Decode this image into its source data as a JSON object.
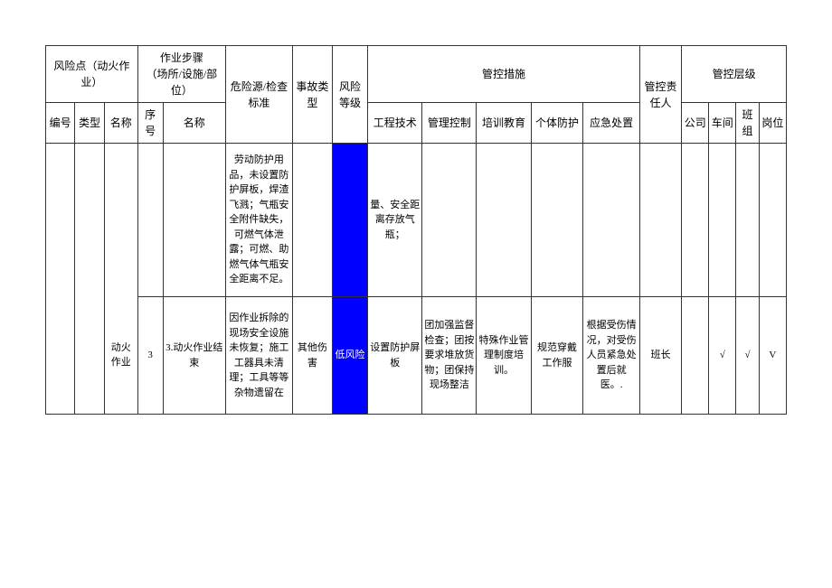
{
  "header": {
    "risk_point": "风险点（动火作业）",
    "work_steps": "作业步骤\n（场所/设施/部位）",
    "hazard_standard": "危险源/检查标准",
    "accident_type": "事故类型",
    "risk_level": "风险等级",
    "control_measures": "管控措施",
    "responsible": "管控责任人",
    "control_level": "管控层级",
    "sub": {
      "num": "编号",
      "type": "类型",
      "name": "名称",
      "seq": "序号",
      "step_name": "名称",
      "eng": "工程技术",
      "mgmt": "管理控制",
      "train": "培训教育",
      "ppe": "个体防护",
      "emerg": "应急处置",
      "company": "公司",
      "workshop": "车间",
      "team": "班组",
      "post": "岗位"
    }
  },
  "rows": {
    "partial_prev": {
      "hazard": "劳动防护用品，未设置防护屏板，焊渣飞溅；气瓶安全附件缺失，可燃气体泄露；可燃、助燃气体气瓶安全距离不足。",
      "eng": "量、安全距离存放气瓶；"
    },
    "r1": {
      "name": "动火作业",
      "seq": "3",
      "step": "3.动火作业结束",
      "hazard": "因作业拆除的现场安全设施未恢复；施工工器具未清理；工具等等杂物遗留在",
      "accident": "其他伤害",
      "risk": "低风险",
      "eng": "设置防护屏板",
      "mgmt": "团加强监督检查；团按要求堆放货物；团保持现场整洁",
      "train": "特殊作业管理制度培训。",
      "ppe": "规范穿戴工作服",
      "emerg": "根据受伤情况，对受伤人员紧急处置后就医。.",
      "resp": "班长",
      "company": "",
      "workshop": "√",
      "team": "√",
      "post": "V"
    }
  }
}
